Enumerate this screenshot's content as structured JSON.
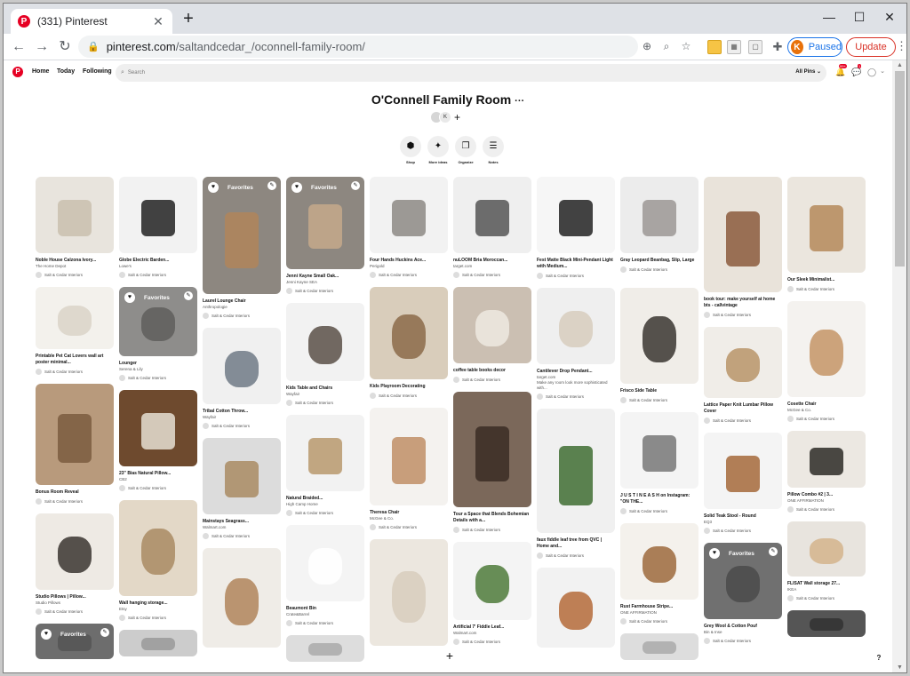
{
  "browser": {
    "tab_title": "(331) Pinterest",
    "tab_favicon": "P",
    "new_tab": "+",
    "url_domain": "pinterest.com",
    "url_path": "/saltandcedar_/oconnell-family-room/",
    "profile_initial": "K",
    "profile_status": "Paused",
    "update_label": "Update"
  },
  "pinterest": {
    "logo": "P",
    "nav": {
      "home": "Home",
      "today": "Today",
      "following": "Following"
    },
    "search_placeholder": "Search",
    "all_pins": "All Pins ⌄",
    "notif_badge": "99+",
    "msg_badge": "1"
  },
  "board": {
    "title": "O'Connell Family Room",
    "more": "···",
    "collaborator_initial": "K",
    "add": "+",
    "tools": [
      {
        "icon": "tag-icon",
        "label": "Shop"
      },
      {
        "icon": "sparkle-icon",
        "label": "More ideas"
      },
      {
        "icon": "organize-icon",
        "label": "Organize"
      },
      {
        "icon": "notes-icon",
        "label": "Notes"
      }
    ]
  },
  "favorites_label": "Favorites",
  "saver": "Salt & Cedar Interiors",
  "columns": [
    [
      {
        "title": "Noble House Calzona Ivory...",
        "source": "The Home Depot",
        "h": 86,
        "color": "#e8e4dd",
        "accent": "#c9bfae"
      },
      {
        "title": "Printable Pet Cat Lovers wall art poster minimal...",
        "source": "",
        "h": 70,
        "color": "#f3f1ec",
        "accent": "#d9d3c8"
      },
      {
        "title": "Bonus Room Reveal",
        "source": "",
        "h": 114,
        "color": "#b89a7c",
        "accent": "#7a5c40"
      },
      {
        "title": "Studio Pillows | Pillow...",
        "source": "Studio Pillows",
        "h": 86,
        "color": "#eeeae4",
        "accent": "#3a3530"
      },
      {
        "title": "",
        "source": "",
        "h": 40,
        "color": "#6d6d6d",
        "accent": "#555",
        "fav": true
      }
    ],
    [
      {
        "title": "Globe Electric Barden...",
        "source": "Lowe's",
        "h": 86,
        "color": "#f2f2f2",
        "accent": "#222"
      },
      {
        "title": "Lounger",
        "source": "Serena & Lily",
        "h": 78,
        "color": "#8e8d8b",
        "accent": "#5f5e5c",
        "fav": true
      },
      {
        "title": "23\" Bias Natural Pillow...",
        "source": "CB2",
        "h": 86,
        "color": "#6e4a2e",
        "accent": "#e6dfd2"
      },
      {
        "title": "Wall hanging storage...",
        "source": "Etsy",
        "h": 108,
        "color": "#e3d8c7",
        "accent": "#a98b63"
      },
      {
        "title": "",
        "source": "",
        "h": 30,
        "color": "#ccc",
        "accent": "#999"
      }
    ],
    [
      {
        "title": "Laurel Lounge Chair",
        "source": "Anthropologie",
        "h": 132,
        "color": "#8d8780",
        "accent": "#b0855a",
        "fav": true
      },
      {
        "title": "Tribal Cotton Throw...",
        "source": "Wayfair",
        "h": 86,
        "color": "#f0f0f0",
        "accent": "#707a86"
      },
      {
        "title": "Mainstays Seagrass...",
        "source": "Walmart.com",
        "h": 86,
        "color": "#dcdcdc",
        "accent": "#a98b63"
      },
      {
        "title": "",
        "source": "",
        "h": 112,
        "color": "#efece7",
        "accent": "#b0855a"
      }
    ],
    [
      {
        "title": "Jenni Kayne Small Oak...",
        "source": "Jenni Kayne SEA",
        "h": 104,
        "color": "#8d8780",
        "accent": "#c5a98b",
        "fav": true
      },
      {
        "title": "Kids Table and Chairs",
        "source": "Wayfair",
        "h": 88,
        "color": "#f2f2f2",
        "accent": "#5b5048"
      },
      {
        "title": "Natural Braided...",
        "source": "High Camp Home",
        "h": 86,
        "color": "#f2f2f2",
        "accent": "#b8996d"
      },
      {
        "title": "Beaumont Bin",
        "source": "Crate&Barrel",
        "h": 86,
        "color": "#f4f4f4",
        "accent": "#ffffff"
      },
      {
        "title": "",
        "source": "",
        "h": 30,
        "color": "#ddd",
        "accent": "#aaa"
      }
    ],
    [
      {
        "title": "Four Hands Huckins Ace...",
        "source": "Perigold",
        "h": 86,
        "color": "#f2f2f2",
        "accent": "#8d8a85"
      },
      {
        "title": "Kids Playroom Decorating",
        "source": "",
        "h": 104,
        "color": "#d9cdbb",
        "accent": "#8b6a49"
      },
      {
        "title": "Theresa Chair",
        "source": "McGee & Co.",
        "h": 110,
        "color": "#f4f2ef",
        "accent": "#c08f66"
      },
      {
        "title": "",
        "source": "",
        "h": 120,
        "color": "#ece7df",
        "accent": "#d8cdbd"
      }
    ],
    [
      {
        "title": "nuLOOM Bria Moroccan...",
        "source": "target.com",
        "h": 86,
        "color": "#efefef",
        "accent": "#555"
      },
      {
        "title": "coffee table books decor",
        "source": "",
        "h": 86,
        "color": "#cbbfb2",
        "accent": "#efe9e1"
      },
      {
        "title": "Tour a Space that Blends Bohemian Details with a...",
        "source": "",
        "h": 130,
        "color": "#7b685a",
        "accent": "#3b2d24"
      },
      {
        "title": "Artificial 7' Fiddle Leaf...",
        "source": "Walmart.com",
        "h": 88,
        "color": "#f4f4f4",
        "accent": "#4d7a3a"
      }
    ],
    [
      {
        "title": "Fest Matte Black Mini-Pendant Light with Medium...",
        "source": "",
        "h": 86,
        "color": "#f6f6f6",
        "accent": "#222"
      },
      {
        "title": "Cantilever Drop Pendant...",
        "source": "target.com",
        "note": "Make any room look more sophisticated with...",
        "h": 86,
        "color": "#efefef",
        "accent": "#d7ccbd"
      },
      {
        "title": "faux fiddle leaf tree from QVC | Home and...",
        "source": "",
        "h": 140,
        "color": "#f0f0f0",
        "accent": "#3f6d32"
      },
      {
        "title": "",
        "source": "",
        "h": 90,
        "color": "#f2f2f2",
        "accent": "#b56b3a"
      }
    ],
    [
      {
        "title": "Gray Leopard Beanbag, Slip, Large",
        "source": "",
        "h": 86,
        "color": "#ececec",
        "accent": "#9c9895"
      },
      {
        "title": "Frisco Side Table",
        "source": "",
        "h": 108,
        "color": "#f0ede8",
        "accent": "#3a3530"
      },
      {
        "title": "J U S T I N E A S H on Instagram: \"ON THE...",
        "source": "",
        "h": 86,
        "color": "#f4f4f4",
        "accent": "#777"
      },
      {
        "title": "Rust Farmhouse Stripe...",
        "source": "ONE AFFIRMATION",
        "h": 86,
        "color": "#f4f1ec",
        "accent": "#9c6a3d"
      },
      {
        "title": "",
        "source": "",
        "h": 30,
        "color": "#ddd",
        "accent": "#aaa"
      }
    ],
    [
      {
        "title": "book tour: make yourself at home bts - callvintage",
        "source": "",
        "h": 130,
        "color": "#e9e3da",
        "accent": "#8b5a3c"
      },
      {
        "title": "Lattice Paper Knit Lumbar Pillow Cover",
        "source": "",
        "h": 80,
        "color": "#f0ede8",
        "accent": "#b89468"
      },
      {
        "title": "Solid Teak Stool - Round",
        "source": "EQ3",
        "h": 86,
        "color": "#f4f4f4",
        "accent": "#a5683a"
      },
      {
        "title": "Grey Wool & Cotton Pouf",
        "source": "Bin & Inse",
        "h": 86,
        "color": "#707070",
        "accent": "#4a4a4a",
        "fav": true
      }
    ],
    [
      {
        "title": "Our Sleek Minimalist...",
        "source": "",
        "h": 108,
        "color": "#ebe6de",
        "accent": "#b5885a"
      },
      {
        "title": "Cosette Chair",
        "source": "McGee & Co.",
        "h": 108,
        "color": "#f4f2ef",
        "accent": "#c49566"
      },
      {
        "title": "Pillow Combo #2 | 3...",
        "source": "ONE AFFIRMATION",
        "h": 64,
        "color": "#ece8e2",
        "accent": "#2d2a26"
      },
      {
        "title": "FLISAT Wall storage 27...",
        "source": "IKEA",
        "h": 62,
        "color": "#e8e4de",
        "accent": "#d3b48c"
      },
      {
        "title": "",
        "source": "",
        "h": 30,
        "color": "#555",
        "accent": "#333"
      }
    ]
  ]
}
